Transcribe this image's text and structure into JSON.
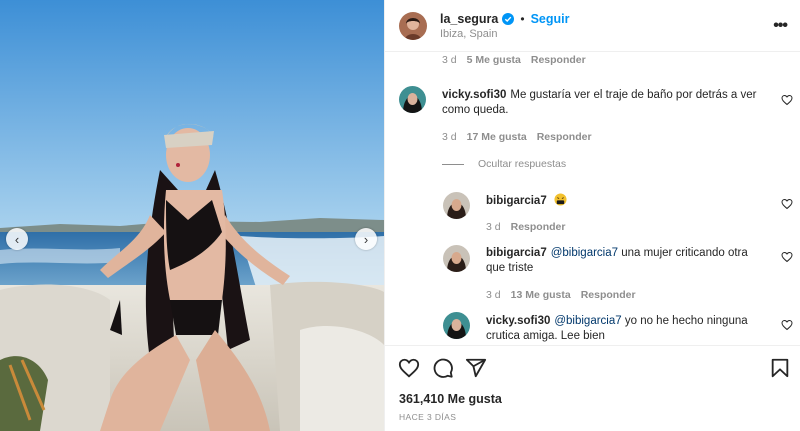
{
  "post": {
    "username": "la_segura",
    "follow_label": "Seguir",
    "location": "Ibiza, Spain",
    "separator": "•",
    "more_label": "•••"
  },
  "photo": {
    "prev_arrow": "‹",
    "next_arrow": "›"
  },
  "comments": {
    "top_meta": {
      "age": "3 d",
      "likes": "5 Me gusta",
      "reply": "Responder"
    },
    "c1": {
      "username": "vicky.sofi30",
      "text": "Me gustaría ver el traje de baño por detrás a ver como queda.",
      "age": "3 d",
      "likes": "17 Me gusta",
      "reply": "Responder"
    },
    "hide_replies": "Ocultar respuestas",
    "r1": {
      "username": "bibigarcia7",
      "emoji": "face-with-symbols-emoji",
      "age": "3 d",
      "reply": "Responder"
    },
    "r2": {
      "username": "bibigarcia7",
      "mention": "@bibigarcia7",
      "text": "una mujer criticando otra que triste",
      "age": "3 d",
      "likes": "13 Me gusta",
      "reply": "Responder"
    },
    "r3": {
      "username": "vicky.sofi30",
      "mention": "@bibigarcia7",
      "text": "yo no he hecho ninguna crutica amiga. Lee bien"
    }
  },
  "actions": {
    "likes_count": "361,410 Me gusta",
    "posted_ago": "HACE 3 DÍAS",
    "icons": [
      "heart-icon",
      "comment-icon",
      "share-icon",
      "bookmark-icon"
    ]
  },
  "colors": {
    "accent": "#0095f6",
    "verified": "#0095f6",
    "muted": "#8e8e8e",
    "text": "#262626",
    "mention": "#00376b"
  }
}
